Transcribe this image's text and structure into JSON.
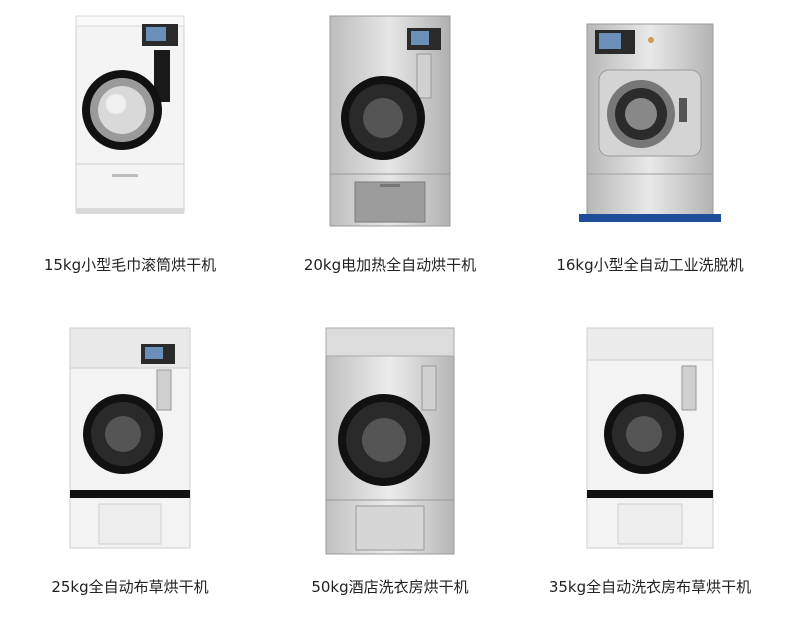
{
  "products": [
    {
      "caption": "15kg小型毛巾滚筒烘干机",
      "icon": "white-compact-dryer"
    },
    {
      "caption": "20kg电加热全自动烘干机",
      "icon": "steel-electric-dryer"
    },
    {
      "caption": "16kg小型全自动工业洗脱机",
      "icon": "steel-washer-extractor"
    },
    {
      "caption": "25kg全自动布草烘干机",
      "icon": "white-dryer-black-band"
    },
    {
      "caption": "50kg酒店洗衣房烘干机",
      "icon": "steel-large-dryer"
    },
    {
      "caption": "35kg全自动洗衣房布草烘干机",
      "icon": "white-dryer-black-band"
    }
  ]
}
